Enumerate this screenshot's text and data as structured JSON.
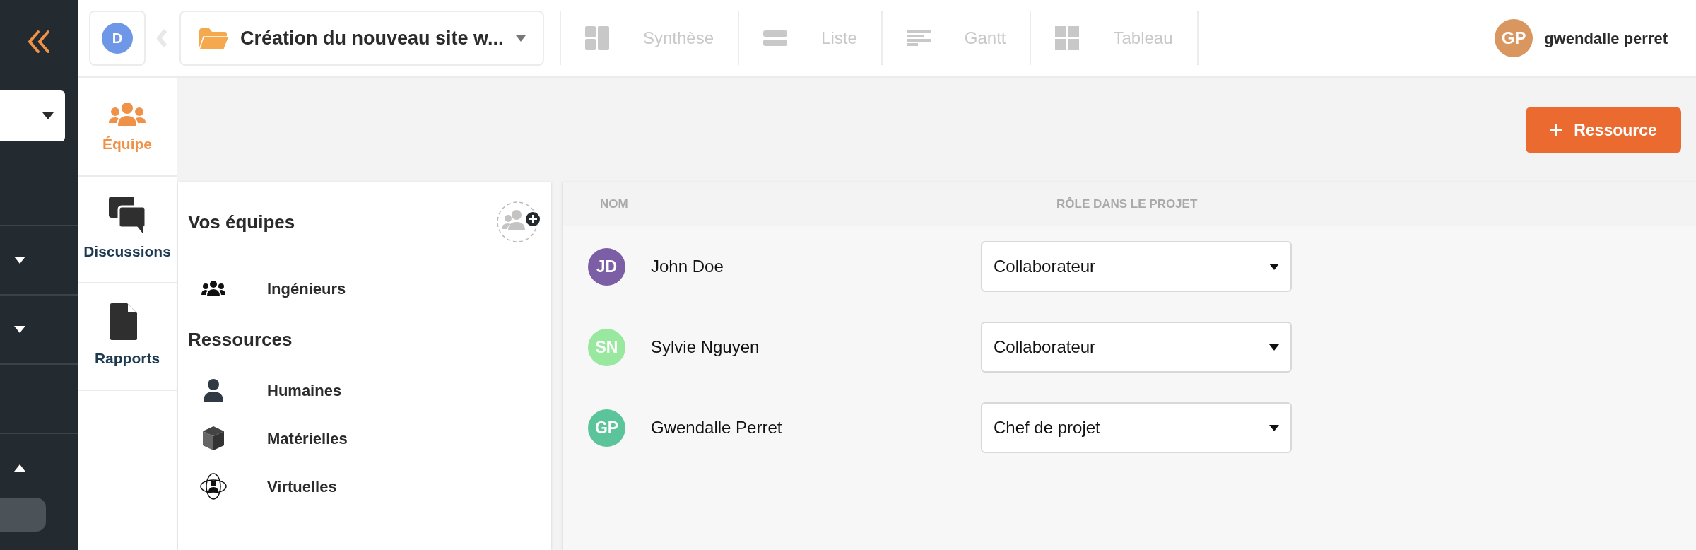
{
  "sidebar": {
    "sections": [
      {
        "expanded": false
      },
      {
        "expanded": false
      },
      {
        "expanded": true
      }
    ]
  },
  "workspace": {
    "initial": "D",
    "color": "#6f97e8"
  },
  "project": {
    "name": "Création du nouveau site w..."
  },
  "views": [
    {
      "label": "Synthèse",
      "kind": "synthese",
      "selected": false
    },
    {
      "label": "Liste",
      "kind": "list",
      "selected": false
    },
    {
      "label": "Gantt",
      "kind": "gantt",
      "selected": false
    },
    {
      "label": "Tableau",
      "kind": "board",
      "selected": false
    }
  ],
  "user": {
    "initials": "GP",
    "name": "gwendalle perret",
    "color": "#d9965e"
  },
  "side_nav": [
    {
      "label": "Équipe",
      "kind": "team",
      "selected": true
    },
    {
      "label": "Discussions",
      "kind": "chat",
      "selected": false
    },
    {
      "label": "Rapports",
      "kind": "report",
      "selected": false
    }
  ],
  "add_button": {
    "label": "Ressource"
  },
  "teams": {
    "title": "Vos équipes",
    "items": [
      {
        "label": "Ingénieurs",
        "kind": "team"
      }
    ]
  },
  "resources": {
    "title": "Ressources",
    "items": [
      {
        "label": "Humaines",
        "kind": "human"
      },
      {
        "label": "Matérielles",
        "kind": "material"
      },
      {
        "label": "Virtuelles",
        "kind": "virtual"
      }
    ]
  },
  "table": {
    "columns": [
      "NOM",
      "RÔLE DANS LE PROJET"
    ],
    "rows": [
      {
        "initials": "JD",
        "name": "John Doe",
        "color": "#7b5ea6",
        "role": "Collaborateur"
      },
      {
        "initials": "SN",
        "name": "Sylvie Nguyen",
        "color": "#98e8a0",
        "role": "Collaborateur"
      },
      {
        "initials": "GP",
        "name": "Gwendalle Perret",
        "color": "#5cc49a",
        "role": "Chef de projet"
      }
    ]
  }
}
